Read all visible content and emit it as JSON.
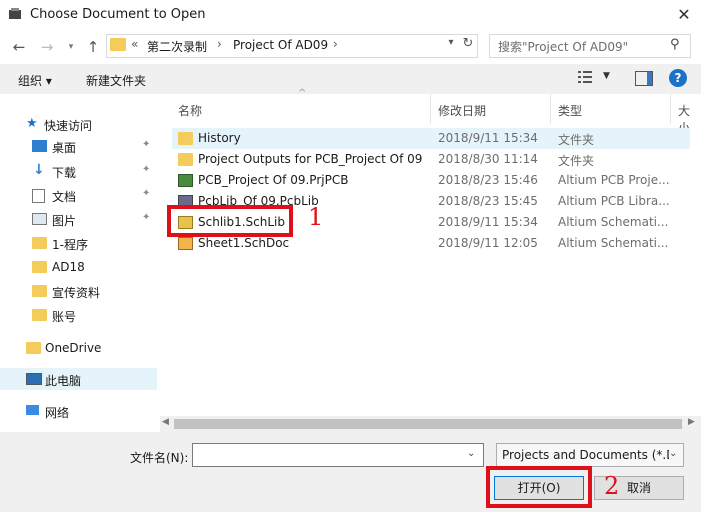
{
  "window": {
    "title": "Choose Document to Open"
  },
  "address": {
    "overflow": "«",
    "segments": [
      "第二次录制",
      "Project Of AD09"
    ]
  },
  "search": {
    "placeholder": "搜索\"Project Of AD09\""
  },
  "toolbar": {
    "organize": "组织 ▾",
    "new_folder": "新建文件夹"
  },
  "nav": {
    "quick_access": "快速访问",
    "items": [
      "桌面",
      "下载",
      "文档",
      "图片",
      "1-程序",
      "AD18",
      "宣传资料",
      "账号"
    ],
    "onedrive": "OneDrive",
    "this_pc": "此电脑",
    "network": "网络"
  },
  "columns": {
    "name": "名称",
    "date": "修改日期",
    "type": "类型",
    "size": "大小"
  },
  "files": [
    {
      "name": "History",
      "date": "2018/9/11 15:34",
      "type": "文件夹",
      "icon": "folder-icon"
    },
    {
      "name": "Project Outputs for PCB_Project Of 09",
      "date": "2018/8/30 11:14",
      "type": "文件夹",
      "icon": "folder-icon"
    },
    {
      "name": "PCB_Project Of 09.PrjPCB",
      "date": "2018/8/23 15:46",
      "type": "Altium PCB Proje...",
      "icon": "pcb-project-icon"
    },
    {
      "name": "PcbLib_Of 09.PcbLib",
      "date": "2018/8/23 15:45",
      "type": "Altium PCB Libra...",
      "icon": "pcblib-icon"
    },
    {
      "name": "Schlib1.SchLib",
      "date": "2018/9/11 15:34",
      "type": "Altium Schemati...",
      "icon": "schlib-icon"
    },
    {
      "name": "Sheet1.SchDoc",
      "date": "2018/9/11 12:05",
      "type": "Altium Schemati...",
      "icon": "schdoc-icon"
    }
  ],
  "annotations": {
    "marker1": "1",
    "marker2": "2",
    "color": "#e0101a"
  },
  "bottom": {
    "filename_label": "文件名(N):",
    "filename_value": "",
    "filter": "Projects and Documents (*.D",
    "open": "打开(O)",
    "cancel": "取消"
  }
}
